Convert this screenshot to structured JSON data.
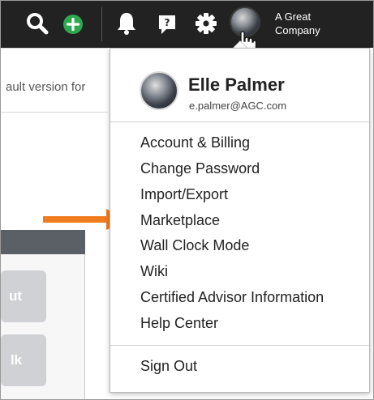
{
  "topbar": {
    "icons": [
      "search-icon",
      "add-icon",
      "bell-icon",
      "help-icon",
      "gear-icon"
    ],
    "add_color": "#2ea84e",
    "company_line1": "A Great",
    "company_line2": "Company"
  },
  "background": {
    "partial_text": "ault version for",
    "button1_partial": "ut",
    "button2_partial": "lk"
  },
  "annotation": {
    "arrow_color": "#f07c20"
  },
  "user_menu": {
    "name": "Elle Palmer",
    "email": "e.palmer@AGC.com",
    "items": [
      {
        "label": "Account & Billing"
      },
      {
        "label": "Change Password"
      },
      {
        "label": "Import/Export"
      },
      {
        "label": "Marketplace"
      },
      {
        "label": "Wall Clock Mode"
      },
      {
        "label": "Wiki"
      },
      {
        "label": "Certified Advisor Information"
      },
      {
        "label": "Help Center"
      }
    ],
    "sign_out": "Sign Out"
  }
}
